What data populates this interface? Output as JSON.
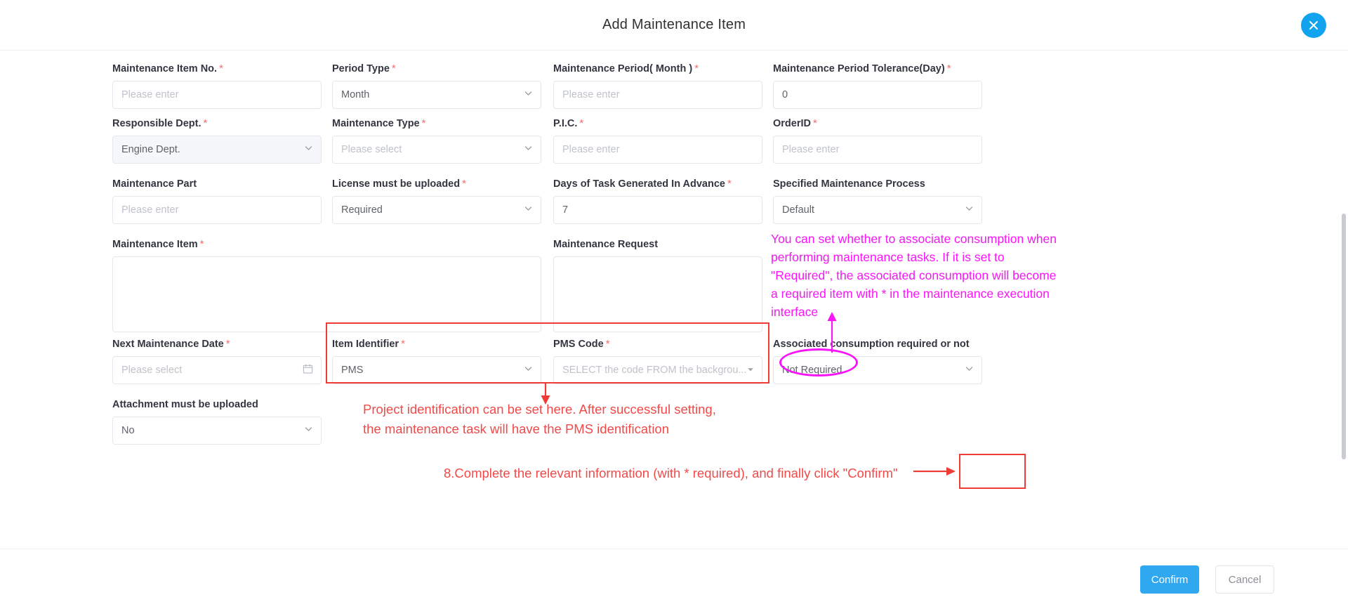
{
  "header": {
    "title": "Add Maintenance Item",
    "close_icon": "close-icon"
  },
  "form": {
    "rows": [
      {
        "fields": [
          {
            "label": "Maintenance Item No.",
            "required": true,
            "type": "input",
            "value": "",
            "placeholder": "Please enter"
          },
          {
            "label": "Period Type",
            "required": true,
            "type": "select",
            "value": "Month",
            "placeholder": ""
          },
          {
            "label": "Maintenance Period( Month )",
            "required": true,
            "type": "input",
            "value": "",
            "placeholder": "Please enter"
          },
          {
            "label": "Maintenance Period Tolerance(Day)",
            "required": true,
            "type": "input",
            "value": "0",
            "placeholder": ""
          }
        ]
      },
      {
        "fields": [
          {
            "label": "Responsible Dept.",
            "required": true,
            "type": "select",
            "value": "Engine Dept.",
            "disabled": true,
            "placeholder": ""
          },
          {
            "label": "Maintenance Type",
            "required": true,
            "type": "select",
            "value": "",
            "placeholder": "Please select"
          },
          {
            "label": "P.I.C.",
            "required": true,
            "type": "input",
            "value": "",
            "placeholder": "Please enter"
          },
          {
            "label": "OrderID",
            "required": true,
            "type": "input",
            "value": "",
            "placeholder": "Please enter"
          }
        ]
      },
      {
        "fields": [
          {
            "label": "Maintenance Part",
            "required": false,
            "type": "input",
            "value": "",
            "placeholder": "Please enter"
          },
          {
            "label": "License must be uploaded",
            "required": true,
            "type": "select",
            "value": "Required",
            "placeholder": ""
          },
          {
            "label": "Days of Task Generated In Advance",
            "required": true,
            "type": "input",
            "value": "7",
            "placeholder": ""
          },
          {
            "label": "Specified Maintenance Process",
            "required": false,
            "type": "select",
            "value": "Default",
            "placeholder": ""
          }
        ]
      },
      {
        "fields": [
          {
            "label": "Maintenance Item",
            "required": true,
            "type": "textarea",
            "value": "",
            "placeholder": ""
          },
          {
            "label": "Maintenance Request",
            "required": false,
            "type": "textarea",
            "value": "",
            "placeholder": ""
          }
        ]
      },
      {
        "fields": [
          {
            "label": "Next Maintenance Date",
            "required": true,
            "type": "date",
            "value": "",
            "placeholder": "Please select"
          },
          {
            "label": "Item Identifier",
            "required": true,
            "type": "select",
            "value": "PMS",
            "placeholder": ""
          },
          {
            "label": "PMS Code",
            "required": true,
            "type": "select-search",
            "value": "",
            "placeholder": "SELECT the code FROM the backgrou..."
          },
          {
            "label": "Associated consumption required or not",
            "required": false,
            "type": "select",
            "value": "Not Required",
            "placeholder": ""
          }
        ]
      },
      {
        "fields": [
          {
            "label": "Attachment must be uploaded",
            "required": false,
            "type": "select",
            "value": "No",
            "placeholder": ""
          }
        ]
      }
    ]
  },
  "footer": {
    "confirm_label": "Confirm",
    "cancel_label": "Cancel"
  },
  "annotations": {
    "magenta_note": "You can set whether to associate consumption when performing maintenance tasks. If it is set to \"Required\", the associated consumption will become a required item with * in the maintenance execution interface",
    "magenta_note_lines": [
      "You can set whether to associate consumption when",
      "performing maintenance tasks. If it is set to",
      "\"Required\", the associated consumption will become",
      "a required item with * in the maintenance execution",
      "interface"
    ],
    "red_note_pms_lines": [
      "Project identification can be set here. After successful setting,",
      "the maintenance task will have the PMS identification"
    ],
    "red_note_footer": "8.Complete the relevant information (with * required), and finally click \"Confirm\"",
    "magenta_color": "#f914f9",
    "red_color": "#f04a49",
    "redbox_color": "#ef3b36"
  }
}
